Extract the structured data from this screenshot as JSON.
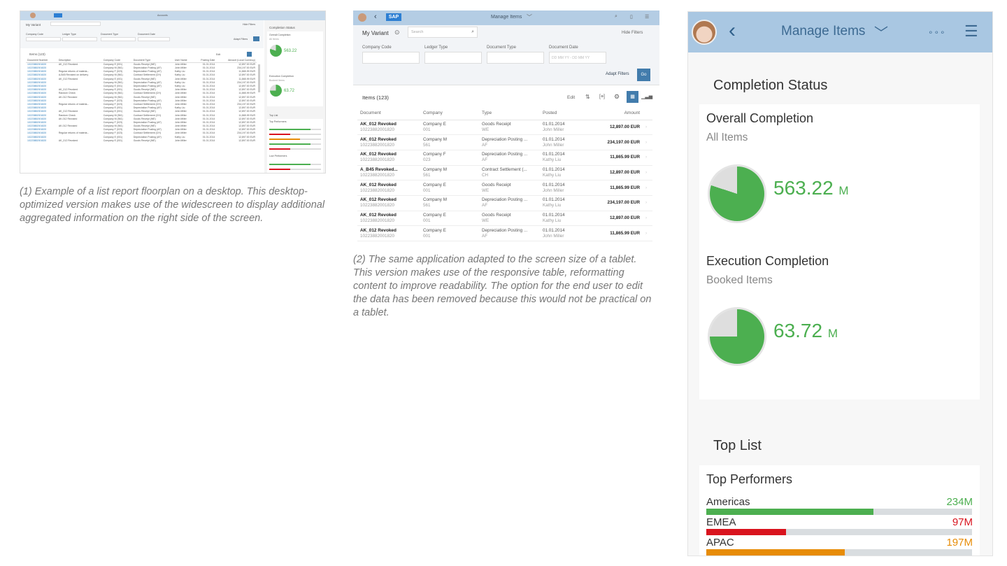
{
  "colors": {
    "accent": "#427cac",
    "green": "#4caf50",
    "red": "#d9141e",
    "orange": "#e78c07",
    "header": "#a9c7e2"
  },
  "desktop": {
    "title": "Accounts",
    "variant": "My Variant",
    "search_placeholder": "Search",
    "hide_filters": "Hide Filters",
    "filters": [
      "Company Code",
      "Ledger Type",
      "Document Type",
      "Document Date"
    ],
    "date_placeholder": "DD MM YY - DD MM YY",
    "adapt_filters": "Adapt Filters",
    "go": "Go",
    "items_title": "Items (123)",
    "edit": "Edit",
    "columns": [
      "Document Number",
      "Description",
      "Company Code",
      "Document Type",
      "User Name",
      "Posting Date",
      "Amount (Local Currency)"
    ],
    "rows": [
      [
        "10223882001820",
        "AK_012 Revoked",
        "Company E (001)",
        "Goods Receipt (WE)",
        "John Miller",
        "01.01.2014",
        "12,897.00 EUR"
      ],
      [
        "10223882001820",
        "",
        "Company M (561)",
        "Depreciation Posting (AF)",
        "John Miller",
        "01.01.2014",
        "234,197.00 EUR"
      ],
      [
        "10223882001820",
        "Regular returns of materia...",
        "Company F (023)",
        "Depreciation Posting (AF)",
        "Kathy Liu",
        "01.01.2014",
        "11,865.99 EUR"
      ],
      [
        "10223882001820",
        "A-B45 Revoked on delivery",
        "Company M (561)",
        "Contract Settlement (CH)",
        "Kathy Liu",
        "01.01.2014",
        "12,897.00 EUR"
      ],
      [
        "10223882001820",
        "AK_012 Revoked",
        "Company E (001)",
        "Goods Receipt (WE)",
        "John Miller",
        "01.01.2014",
        "11,865.99 EUR"
      ],
      [
        "10223882001820",
        "",
        "Company M (561)",
        "Depreciation Posting (AF)",
        "Kathy Liu",
        "01.01.2014",
        "234,197.00 EUR"
      ],
      [
        "10223882001820",
        "",
        "Company E (001)",
        "Depreciation Posting (AF)",
        "Kathy Liu",
        "01.01.2014",
        "12,897.00 EUR"
      ],
      [
        "10223882001820",
        "AK_012 Revoked",
        "Company E (001)",
        "Goods Receipt (WE)",
        "John Miller",
        "01.01.2014",
        "12,897.00 EUR"
      ],
      [
        "10223882001820",
        "Random Check",
        "Company M (561)",
        "Contract Settlement (CH)",
        "John Miller",
        "01.01.2014",
        "11,865.99 EUR"
      ],
      [
        "10223882001820",
        "AK-012 Revoked",
        "Company M (561)",
        "Goods Receipt (WE)",
        "John Miller",
        "01.01.2014",
        "12,897.00 EUR"
      ],
      [
        "10223882001820",
        "",
        "Company F (023)",
        "Depreciation Posting (AF)",
        "John Miller",
        "01.01.2014",
        "12,897.00 EUR"
      ],
      [
        "10223882001820",
        "Regular returns of materia...",
        "Company F (023)",
        "Contract Settlement (CH)",
        "John Miller",
        "01.01.2014",
        "234,197.00 EUR"
      ],
      [
        "10223882001820",
        "",
        "Company E (001)",
        "Depreciation Posting (AF)",
        "Kathy Liu",
        "01.01.2014",
        "12,897.00 EUR"
      ],
      [
        "10223882001820",
        "AK_012 Revoked",
        "Company E (001)",
        "Goods Receipt (WE)",
        "John Miller",
        "01.01.2014",
        "12,897.00 EUR"
      ],
      [
        "10223882001820",
        "Random Check",
        "Company M (561)",
        "Contract Settlement (CH)",
        "John Miller",
        "01.01.2014",
        "11,865.99 EUR"
      ],
      [
        "10223882001820",
        "AK-012 Revoked",
        "Company M (561)",
        "Goods Receipt (WE)",
        "John Miller",
        "01.01.2014",
        "12,897.00 EUR"
      ],
      [
        "10223882001820",
        "",
        "Company F (023)",
        "Depreciation Posting (AF)",
        "John Miller",
        "01.01.2014",
        "12,897.00 EUR"
      ],
      [
        "10223882001820",
        "AK-012 Revoked",
        "Company M (561)",
        "Goods Receipt (WE)",
        "John Miller",
        "01.01.2014",
        "12,897.00 EUR"
      ],
      [
        "10223882001820",
        "",
        "Company F (023)",
        "Depreciation Posting (AF)",
        "John Miller",
        "01.01.2014",
        "12,897.00 EUR"
      ],
      [
        "10223882001820",
        "Regular returns of materia...",
        "Company F (023)",
        "Contract Settlement (CH)",
        "John Miller",
        "01.01.2014",
        "234,197.00 EUR"
      ],
      [
        "10223882001820",
        "",
        "Company E (001)",
        "Depreciation Posting (AF)",
        "Kathy Liu",
        "01.01.2014",
        "12,897.00 EUR"
      ],
      [
        "10223882001820",
        "AK_012 Revoked",
        "Company E (001)",
        "Goods Receipt (WE)",
        "John Miller",
        "01.01.2014",
        "12,897.00 EUR"
      ]
    ],
    "side": {
      "title": "Completion Status",
      "overall": "Overall Completion",
      "all_items": "All Items",
      "overall_value": "563.22",
      "exec": "Execution Completion",
      "booked": "Booked Items",
      "exec_value": "63.72",
      "unit": "M",
      "top_list": "Top List",
      "top_performers": "Top Performers",
      "low_performers": "Low Performers"
    }
  },
  "caption1": "(1) Example of a list report floorplan on a desktop. This desktop-optimized version makes use of the widescreen to display additional aggregated information on the right side of the screen.",
  "tablet": {
    "title": "Manage Items",
    "variant": "My Variant",
    "search_placeholder": "Search",
    "hide_filters": "Hide Filters",
    "filters": [
      "Company Code",
      "Ledger Type",
      "Document Type",
      "Document Date"
    ],
    "date_placeholder": "DD MM YY - DD MM YY",
    "adapt_filters": "Adapt Filters",
    "go": "Go",
    "items_title": "Items (123)",
    "edit": "Edit",
    "columns": [
      "Document",
      "Company",
      "Type",
      "Posted",
      "Amount"
    ],
    "rows": [
      [
        "AK_012 Revoked",
        "10223882001820",
        "Company E",
        "001",
        "Goods Receipt",
        "WE",
        "01.01.2014",
        "John Miller",
        "12,897.00 EUR"
      ],
      [
        "AK_012 Revoked",
        "10223882001820",
        "Company M",
        "561",
        "Depreciation Posting ...",
        "AF",
        "01.01.2014",
        "John Miller",
        "234,197.00 EUR"
      ],
      [
        "AK_012 Revoked",
        "10223882001820",
        "Company F",
        "023",
        "Depreciation Posting ...",
        "AF",
        "01.01.2014",
        "Kathy Liu",
        "11,865.99 EUR"
      ],
      [
        "A_B45 Revoked...",
        "10223882001820",
        "Company M",
        "561",
        "Contract Settlement (...",
        "CH",
        "01.01.2014",
        "Kathy Liu",
        "12,897.00 EUR"
      ],
      [
        "AK_012 Revoked",
        "10223882001820",
        "Company E",
        "001",
        "Goods Receipt",
        "WE",
        "01.01.2014",
        "John Miller",
        "11,865.99 EUR"
      ],
      [
        "AK_012 Revoked",
        "10223882001820",
        "Company M",
        "561",
        "Depreciation Posting ...",
        "AF",
        "01.01.2014",
        "Kathy Liu",
        "234,197.00 EUR"
      ],
      [
        "AK_012 Revoked",
        "10223882001820",
        "Company E",
        "001",
        "Goods Receipt",
        "WE",
        "01.01.2014",
        "Kathy Liu",
        "12,897.00 EUR"
      ],
      [
        "AK_012 Revoked",
        "10223882001820",
        "Company E",
        "001",
        "Depreciation Posting ...",
        "AF",
        "01.01.2014",
        "John Miller",
        "11,865.99 EUR"
      ]
    ]
  },
  "caption2": "(2) The same application adapted to the screen size of a tablet. This version makes use of the responsive table, reformatting content to improve readability. The option for the end user to edit the data has been removed because this would not be practical on a tablet.",
  "phone": {
    "title": "Manage Items",
    "section1": "Completion Status",
    "overall": {
      "title": "Overall Completion",
      "subtitle": "All Items",
      "value": "563.22",
      "unit": "M",
      "fraction": 0.8
    },
    "exec": {
      "title": "Execution Completion",
      "subtitle": "Booked Items",
      "value": "63.72",
      "unit": "M",
      "fraction": 0.75
    },
    "section2": "Top List",
    "top_performers": "Top Performers",
    "performers": [
      {
        "label": "Americas",
        "value": "234M",
        "fraction": 0.63,
        "color": "#4caf50"
      },
      {
        "label": "EMEA",
        "value": "97M",
        "fraction": 0.3,
        "color": "#d9141e"
      },
      {
        "label": "APAC",
        "value": "197M",
        "fraction": 0.52,
        "color": "#e78c07"
      }
    ]
  }
}
